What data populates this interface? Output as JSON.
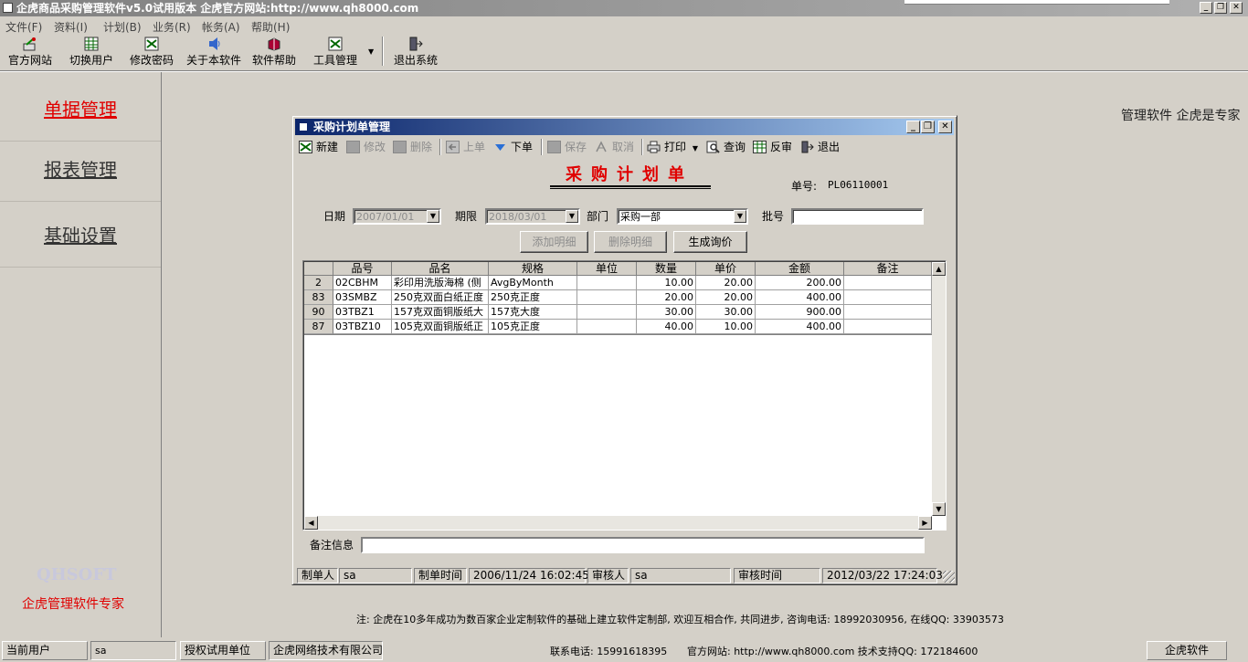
{
  "app": {
    "title": "企虎商品采购管理软件v5.0试用版本 企虎官方网站:http://www.qh8000.com"
  },
  "window_controls": {
    "minimize": "_",
    "restore": "❐",
    "close": "✕"
  },
  "menu": [
    {
      "label": "文件(F)"
    },
    {
      "label": "资料(I)"
    },
    {
      "label": "计划(B)"
    },
    {
      "label": "业务(R)"
    },
    {
      "label": "帐务(A)"
    },
    {
      "label": "帮助(H)"
    }
  ],
  "toolbar": [
    {
      "label": "官方网站",
      "icon": "website-icon"
    },
    {
      "label": "切换用户",
      "icon": "switch-user-icon"
    },
    {
      "label": "修改密码",
      "icon": "password-icon"
    },
    {
      "label": "关于本软件",
      "icon": "about-icon"
    },
    {
      "label": "软件帮助",
      "icon": "help-book-icon"
    },
    {
      "label": "工具管理",
      "icon": "tools-icon"
    },
    {
      "label": "退出系统",
      "icon": "exit-icon"
    }
  ],
  "left_nav": {
    "items": [
      {
        "label": "单据管理",
        "active": true
      },
      {
        "label": "报表管理",
        "active": false
      },
      {
        "label": "基础设置",
        "active": false
      }
    ],
    "logo_text": "QHSOFT",
    "slogan": "企虎管理软件专家"
  },
  "top_right_text": "管理软件  企虎是专家",
  "dialog": {
    "title": "采购计划单管理",
    "toolbar": [
      {
        "label": "新建",
        "enabled": true,
        "icon": "new-icon"
      },
      {
        "label": "修改",
        "enabled": false,
        "icon": "edit-icon"
      },
      {
        "label": "删除",
        "enabled": false,
        "icon": "delete-icon"
      },
      {
        "label": "上单",
        "enabled": false,
        "icon": "prev-icon"
      },
      {
        "label": "下单",
        "enabled": true,
        "icon": "next-icon"
      },
      {
        "label": "保存",
        "enabled": false,
        "icon": "save-icon"
      },
      {
        "label": "取消",
        "enabled": false,
        "icon": "cancel-icon"
      },
      {
        "label": "打印",
        "enabled": true,
        "icon": "print-icon"
      },
      {
        "label": "查询",
        "enabled": true,
        "icon": "search-icon"
      },
      {
        "label": "反审",
        "enabled": true,
        "icon": "unaudit-icon"
      },
      {
        "label": "退出",
        "enabled": true,
        "icon": "exit-icon"
      }
    ],
    "form_title": "采购计划单",
    "doc_no_label": "单号:",
    "doc_no": "PL06110001",
    "fields": {
      "date_label": "日期",
      "date_value": "2007/01/01",
      "deadline_label": "期限",
      "deadline_value": "2018/03/01",
      "dept_label": "部门",
      "dept_value": "采购一部",
      "batch_label": "批号",
      "batch_value": ""
    },
    "buttons": {
      "add_detail": "添加明细",
      "delete_detail": "删除明细",
      "generate_inquiry": "生成询价"
    },
    "grid": {
      "columns": [
        "",
        "品号",
        "品名",
        "规格",
        "单位",
        "数量",
        "单价",
        "金额",
        "备注"
      ],
      "rows": [
        {
          "idx": "2",
          "code": "02CBHM",
          "name": "彩印用洗版海棉 (侧",
          "spec": "AvgByMonth",
          "unit": "",
          "qty": "10.00",
          "price": "20.00",
          "amount": "200.00",
          "remark": ""
        },
        {
          "idx": "83",
          "code": "03SMBZ",
          "name": "250克双面白纸正度",
          "spec": "250克正度",
          "unit": "",
          "qty": "20.00",
          "price": "20.00",
          "amount": "400.00",
          "remark": ""
        },
        {
          "idx": "90",
          "code": "03TBZ1",
          "name": "157克双面铜版纸大",
          "spec": "157克大度",
          "unit": "",
          "qty": "30.00",
          "price": "30.00",
          "amount": "900.00",
          "remark": ""
        },
        {
          "idx": "87",
          "code": "03TBZ10",
          "name": "105克双面铜版纸正",
          "spec": "105克正度",
          "unit": "",
          "qty": "40.00",
          "price": "10.00",
          "amount": "400.00",
          "remark": ""
        }
      ]
    },
    "memo_label": "备注信息",
    "memo_value": "",
    "status": {
      "maker_label": "制单人",
      "maker": "sa",
      "make_time_label": "制单时间",
      "make_time": "2006/11/24 16:02:45",
      "auditor_label": "审核人",
      "auditor": "sa",
      "audit_time_label": "审核时间",
      "audit_time": "2012/03/22 17:24:03"
    }
  },
  "notice": "注: 企虎在10多年成功为数百家企业定制软件的基础上建立软件定制部, 欢迎互相合作, 共同进步, 咨询电话: 18992030956,  在线QQ: 33903573",
  "statusbar": {
    "current_user_label": "当前用户",
    "current_user": "sa",
    "licensed_label": "授权试用单位",
    "company": "企虎网络技术有限公司",
    "phone": "联系电话: 15991618395",
    "website": "官方网站: http://www.qh8000.com 技术支持QQ: 172184600",
    "brand": "企虎软件"
  }
}
